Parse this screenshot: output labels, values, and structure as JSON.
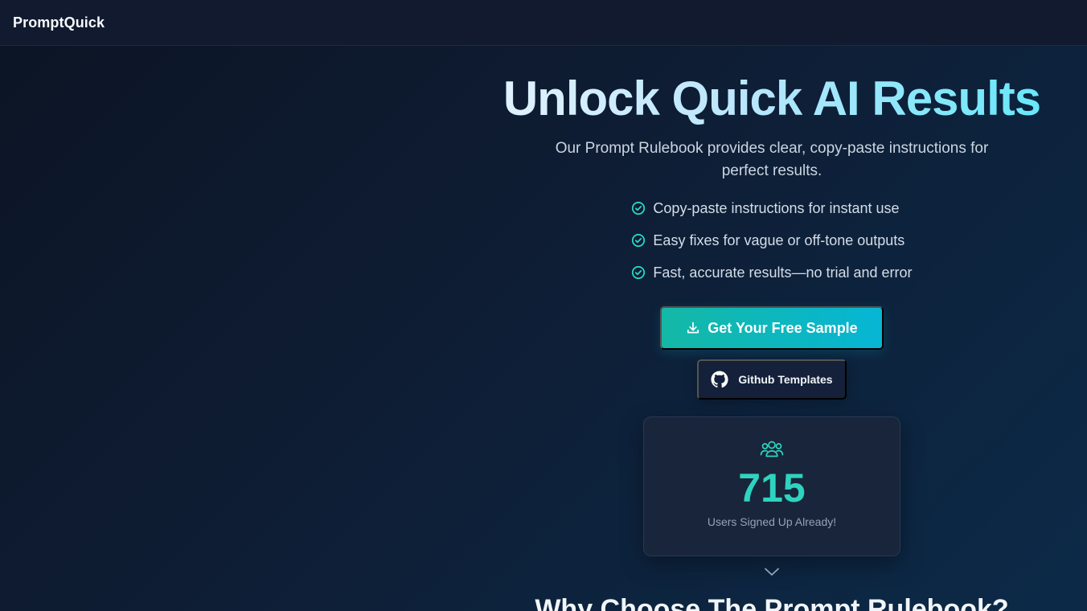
{
  "header": {
    "brand": "PromptQuick"
  },
  "hero": {
    "headline": "Unlock Quick AI Results",
    "subtitle": "Our Prompt Rulebook provides clear, copy-paste instructions for perfect results.",
    "features": [
      "Copy-paste instructions for instant use",
      "Easy fixes for vague or off-tone outputs",
      "Fast, accurate results—no trial and error"
    ],
    "cta_label": "Get Your Free Sample",
    "github_label": "Github Templates"
  },
  "stats": {
    "count": "715",
    "label": "Users Signed Up Already!"
  },
  "next_section": {
    "title": "Why Choose The Prompt Rulebook?"
  },
  "icons": {
    "feature": "check-circle-icon",
    "cta": "download-icon",
    "github": "github-icon",
    "users": "users-icon",
    "scroll": "chevron-down-icon"
  },
  "colors": {
    "accent_teal": "#14b8a6",
    "accent_cyan": "#06b6d4",
    "stat_number": "#2dd4bf",
    "background_dark": "#0c1424",
    "topbar": "#111a2e"
  }
}
